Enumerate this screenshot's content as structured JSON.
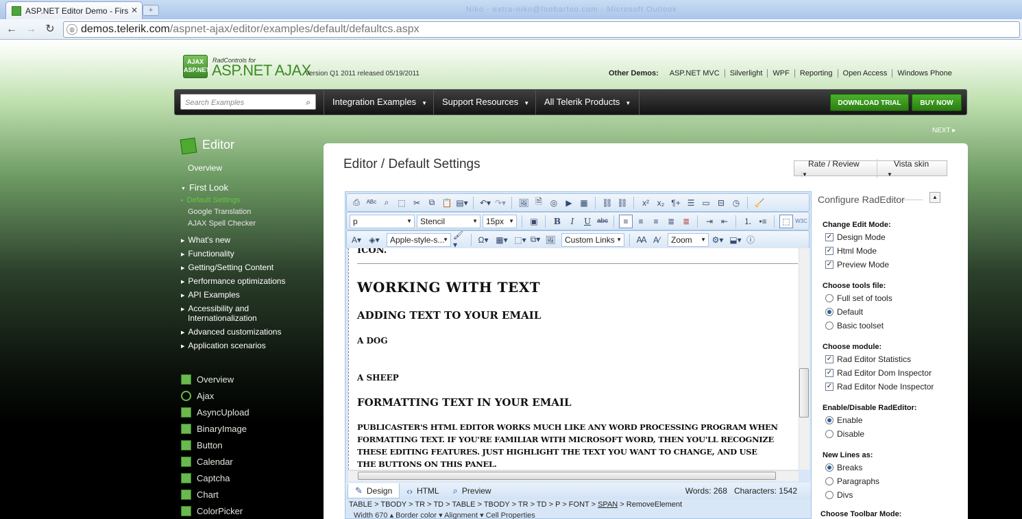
{
  "browser": {
    "tab_title": "ASP.NET Editor Demo - Firs",
    "tab_close": "✕",
    "new_tab": "+",
    "blurred_text": "Niko · extra-niko@foobarfoo.com · Microsoft Outlook",
    "url_host": "demos.telerik.com",
    "url_path": "/aspnet-ajax/editor/examples/default/defaultcs.aspx"
  },
  "header": {
    "logo_text": "AJAX ASP.NET",
    "brand_small": "RadControls for",
    "brand": "ASP.NET AJAX",
    "version": "Version Q1 2011 released 05/19/2011",
    "other_demos_label": "Other Demos:",
    "other_demos": [
      "ASP.NET MVC",
      "Silverlight",
      "WPF",
      "Reporting",
      "Open Access",
      "Windows Phone"
    ]
  },
  "menubar": {
    "search_placeholder": "Search Examples",
    "menus": [
      "Integration Examples",
      "Support Resources",
      "All Telerik Products"
    ],
    "download": "DOWNLOAD TRIAL",
    "buy": "BUY NOW",
    "next": "NEXT ▸"
  },
  "sidebar": {
    "title": "Editor",
    "overview": "Overview",
    "first_look": "First Look",
    "first_look_items": [
      "Default Settings",
      "Google Translation",
      "AJAX Spell Checker"
    ],
    "sections": [
      "What's new",
      "Functionality",
      "Getting/Setting Content",
      "Performance optimizations",
      "API Examples",
      "Accessibility and",
      "Internationalization",
      "Advanced customizations",
      "Application scenarios"
    ],
    "controls": [
      "Overview",
      "Ajax",
      "AsyncUpload",
      "BinaryImage",
      "Button",
      "Calendar",
      "Captcha",
      "Chart",
      "ColorPicker"
    ]
  },
  "main": {
    "title": "Editor / Default Settings",
    "rate": "Rate / Review",
    "skin": "Vista skin"
  },
  "editor": {
    "format_block": "p",
    "font_name": "Stencil",
    "font_size": "15px",
    "css_class": "Apple-style-s...",
    "custom_links": "Custom Links",
    "zoom": "Zoom",
    "doc": {
      "icon_line": "icon.",
      "h1": "Working with Text",
      "h2": "Adding Text to your Email",
      "p1": "A Dog",
      "p2": "A Sheep",
      "h2b": "Formatting Text in your Email",
      "para": [
        "Publicaster's HTML Editor works much like any word processing program when",
        "formatting text. If you're familiar with Microsoft Word, then you'll recognize",
        "these editing features. Just highlight the text you want to change, and use",
        "the buttons on this panel."
      ]
    },
    "modes": [
      "Design",
      "HTML",
      "Preview"
    ],
    "words": "Words: 268",
    "characters": "Characters: 1542",
    "path": [
      "TABLE",
      "TBODY",
      "TR",
      "TD",
      "TABLE",
      "TBODY",
      "TR",
      "TD",
      "P",
      "FONT",
      "SPAN",
      "RemoveElement"
    ],
    "cell_props": "Width  670 ▴  Border color  ▾   Alignment  ▾  Cell Properties"
  },
  "config": {
    "title": "Configure RadEditor",
    "edit_mode_label": "Change Edit Mode:",
    "edit_modes": [
      "Design Mode",
      "Html Mode",
      "Preview Mode"
    ],
    "tools_label": "Choose tools file:",
    "tools": [
      "Full set of tools",
      "Default",
      "Basic toolset"
    ],
    "module_label": "Choose module:",
    "modules": [
      "Rad Editor Statistics",
      "Rad Editor Dom Inspector",
      "Rad Editor Node Inspector"
    ],
    "enable_label": "Enable/Disable RadEditor:",
    "enable": [
      "Enable",
      "Disable"
    ],
    "newlines_label": "New Lines as:",
    "newlines": [
      "Breaks",
      "Paragraphs",
      "Divs"
    ],
    "toolbar_label": "Choose Toolbar Mode:"
  }
}
